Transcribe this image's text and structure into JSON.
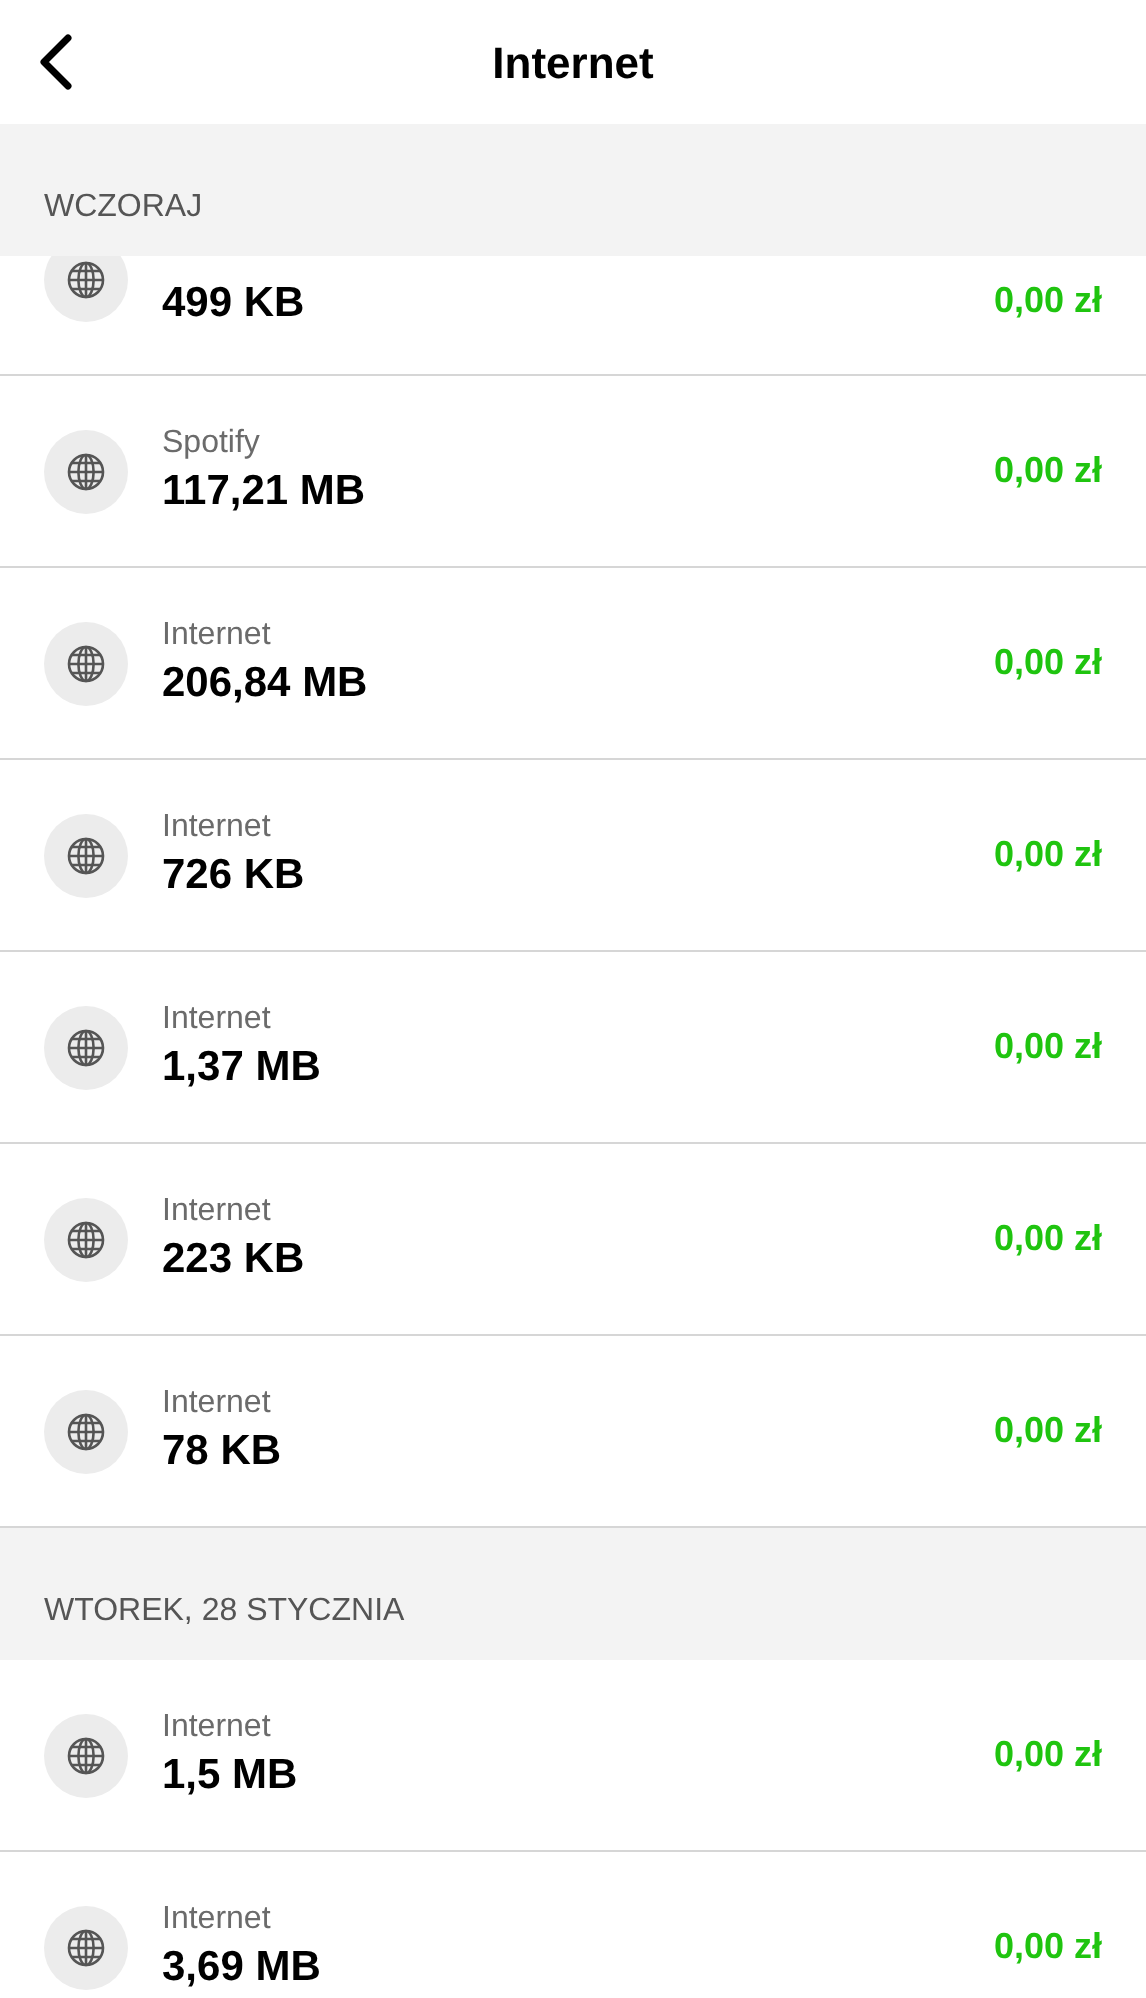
{
  "header": {
    "title": "Internet"
  },
  "sections": [
    {
      "title": "WCZORAJ",
      "items": [
        {
          "value": "499 KB",
          "amount": "0,00 zł",
          "cut": true
        },
        {
          "label": "Spotify",
          "value": "117,21 MB",
          "amount": "0,00 zł"
        },
        {
          "label": "Internet",
          "value": "206,84 MB",
          "amount": "0,00 zł"
        },
        {
          "label": "Internet",
          "value": "726 KB",
          "amount": "0,00 zł"
        },
        {
          "label": "Internet",
          "value": "1,37 MB",
          "amount": "0,00 zł"
        },
        {
          "label": "Internet",
          "value": "223 KB",
          "amount": "0,00 zł"
        },
        {
          "label": "Internet",
          "value": "78 KB",
          "amount": "0,00 zł"
        }
      ]
    },
    {
      "title": "WTOREK, 28 STYCZNIA",
      "items": [
        {
          "label": "Internet",
          "value": "1,5 MB",
          "amount": "0,00 zł"
        },
        {
          "label": "Internet",
          "value": "3,69 MB",
          "amount": "0,00 zł"
        }
      ]
    }
  ]
}
